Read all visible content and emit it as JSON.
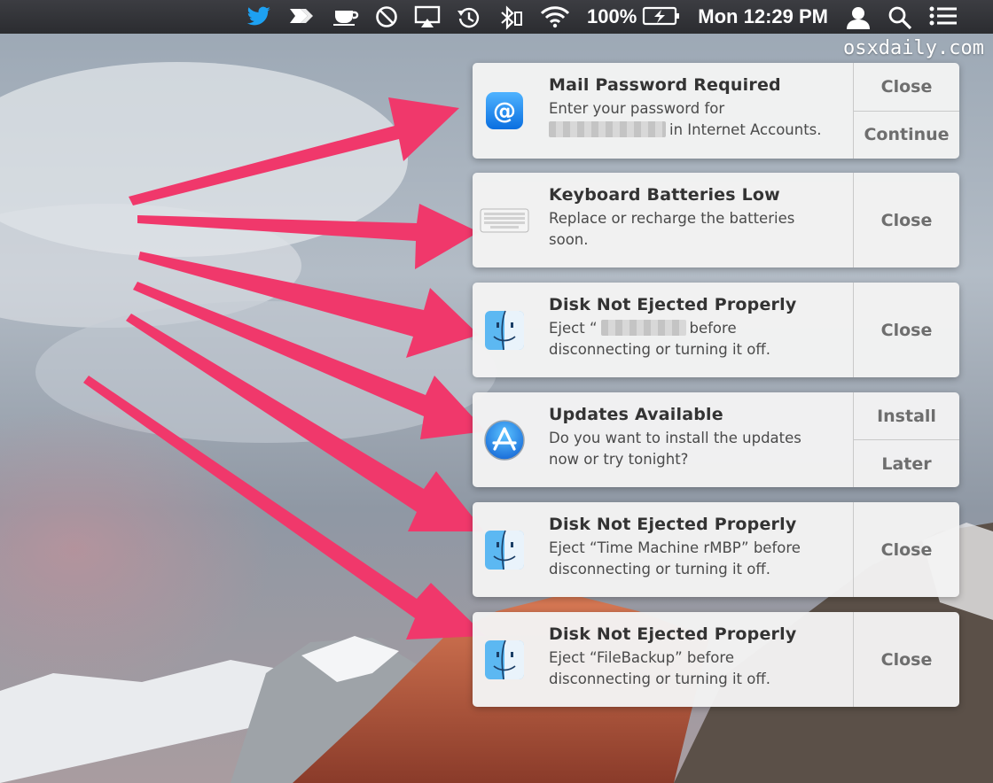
{
  "menubar": {
    "battery_percent": "100%",
    "clock": "Mon 12:29 PM",
    "icons": [
      "twitter-icon",
      "paper-plane-icon",
      "coffee-cup-icon",
      "do-not-disturb-icon",
      "airplay-icon",
      "time-machine-icon",
      "bluetooth-icon",
      "wifi-icon",
      "battery-icon",
      "user-icon",
      "spotlight-icon",
      "notification-center-icon"
    ]
  },
  "watermark": "osxdaily.com",
  "notifications": [
    {
      "title": "Mail Password Required",
      "line1": "Enter your password for",
      "line2": "in Internet Accounts.",
      "icon": "mail-at-icon",
      "actions": [
        "Close",
        "Continue"
      ]
    },
    {
      "title": "Keyboard Batteries Low",
      "line1": "Replace or recharge the batteries",
      "line2": "soon.",
      "icon": "keyboard-icon",
      "actions": [
        "Close"
      ]
    },
    {
      "title": "Disk Not Ejected Properly",
      "line1_prefix": "Eject “",
      "line1_suffix": "before",
      "line2": "disconnecting or turning it off.",
      "icon": "finder-icon",
      "actions": [
        "Close"
      ]
    },
    {
      "title": "Updates Available",
      "line1": "Do you want to install the updates",
      "line2": "now or try tonight?",
      "icon": "app-store-icon",
      "actions": [
        "Install",
        "Later"
      ]
    },
    {
      "title": "Disk Not Ejected Properly",
      "line1": "Eject “Time Machine rMBP” before",
      "line2": "disconnecting or turning it off.",
      "icon": "finder-icon",
      "actions": [
        "Close"
      ]
    },
    {
      "title": "Disk Not Ejected Properly",
      "line1": "Eject “FileBackup” before",
      "line2": "disconnecting or turning it off.",
      "icon": "finder-icon",
      "actions": [
        "Close"
      ]
    }
  ],
  "colors": {
    "arrow": "#f0386b",
    "menubar": "#2f3035",
    "notification_bg": "#f3f3f3"
  }
}
